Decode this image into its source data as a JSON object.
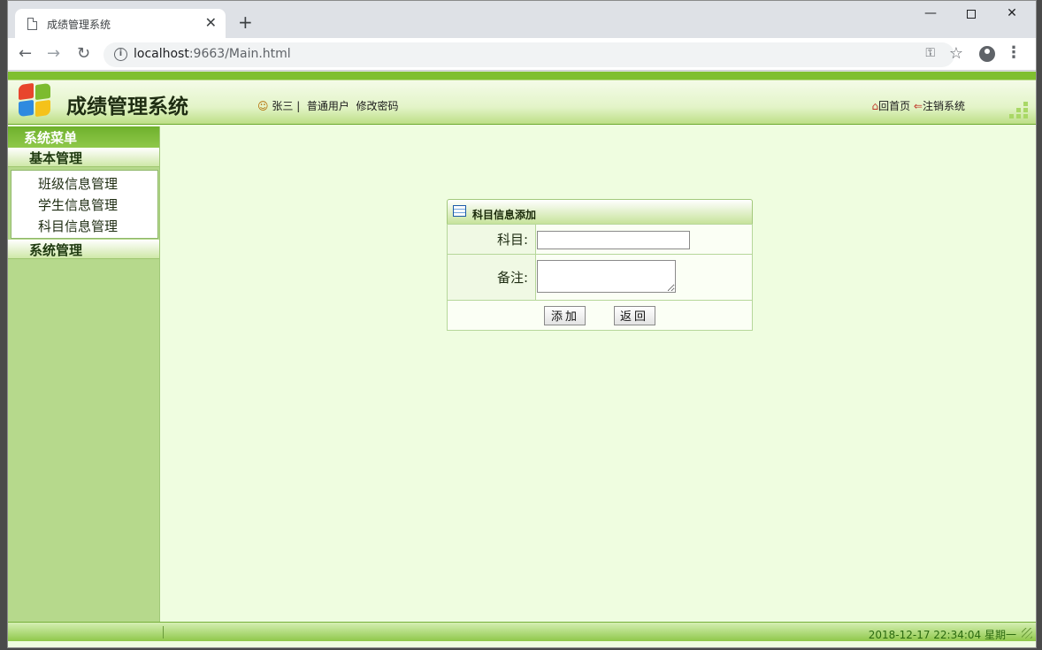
{
  "browser": {
    "tab_title": "成绩管理系统",
    "tab_close": "✕",
    "new_tab": "+",
    "url_host": "localhost",
    "url_rest": ":9663/Main.html"
  },
  "header": {
    "app_title": "成绩管理系统",
    "user_name": "张三",
    "separator": "|",
    "user_role": "普通用户",
    "change_password": "修改密码",
    "home": "回首页",
    "logout": "注销系统"
  },
  "sidebar": {
    "title": "系统菜单",
    "groups": [
      {
        "label": "基本管理",
        "items": [
          "班级信息管理",
          "学生信息管理",
          "科目信息管理"
        ]
      },
      {
        "label": "系统管理",
        "items": []
      }
    ]
  },
  "form": {
    "title": "科目信息添加",
    "subject_label": "科目:",
    "subject_value": "",
    "remark_label": "备注:",
    "remark_value": "",
    "add_button": "添加",
    "back_button": "返回"
  },
  "statusbar": {
    "datetime": "2018-12-17 22:34:04 星期一"
  },
  "colors": {
    "header_green": "#7fbf30",
    "sidebar_bg": "#b6d98c",
    "content_bg": "#effde0"
  }
}
